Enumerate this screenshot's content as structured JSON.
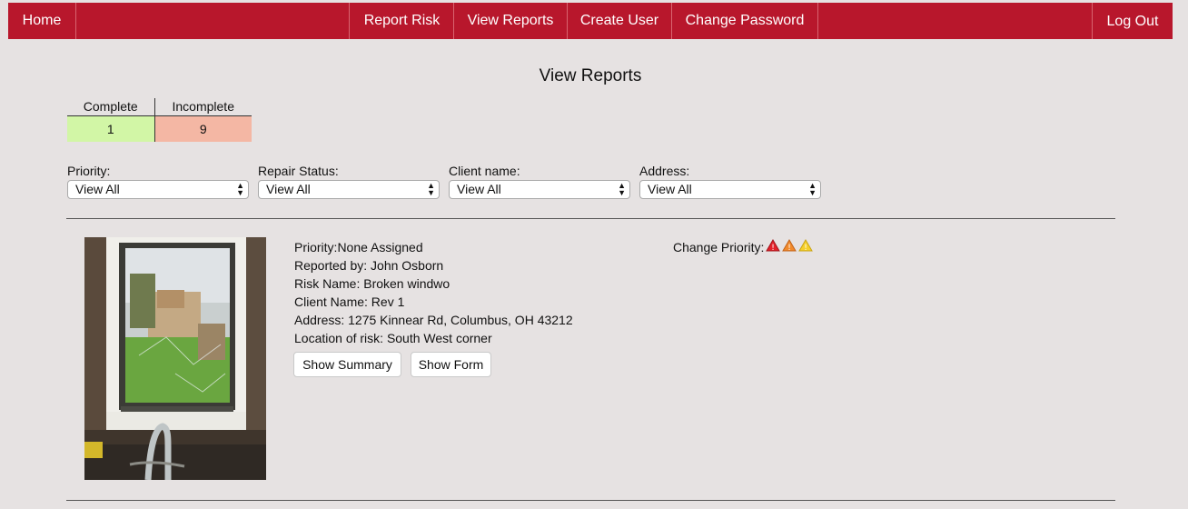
{
  "nav": {
    "home": "Home",
    "report_risk": "Report Risk",
    "view_reports": "View Reports",
    "create_user": "Create User",
    "change_password": "Change Password",
    "log_out": "Log Out",
    "color": "#b8172c"
  },
  "page": {
    "title": "View Reports"
  },
  "summary": {
    "complete_label": "Complete",
    "incomplete_label": "Incomplete",
    "complete_count": "1",
    "incomplete_count": "9",
    "complete_color": "#d2f6a6",
    "incomplete_color": "#f4b7a4"
  },
  "filters": [
    {
      "label": "Priority:",
      "value": "View All"
    },
    {
      "label": "Repair Status:",
      "value": "View All"
    },
    {
      "label": "Client name:",
      "value": "View All"
    },
    {
      "label": "Address:",
      "value": "View All"
    }
  ],
  "report": {
    "priority": "Priority:None Assigned",
    "reported_by": "Reported by: John Osborn",
    "risk_name": "Risk Name: Broken windwo",
    "client_name": "Client Name: Rev 1",
    "address": "Address: 1275 Kinnear Rd, Columbus, OH 43212",
    "location": "Location of risk: South West corner",
    "show_summary": "Show Summary",
    "show_form": "Show Form",
    "change_priority_label": "Change Priority:",
    "priority_icons": [
      "warning-red-icon",
      "warning-orange-icon",
      "warning-yellow-icon"
    ]
  }
}
